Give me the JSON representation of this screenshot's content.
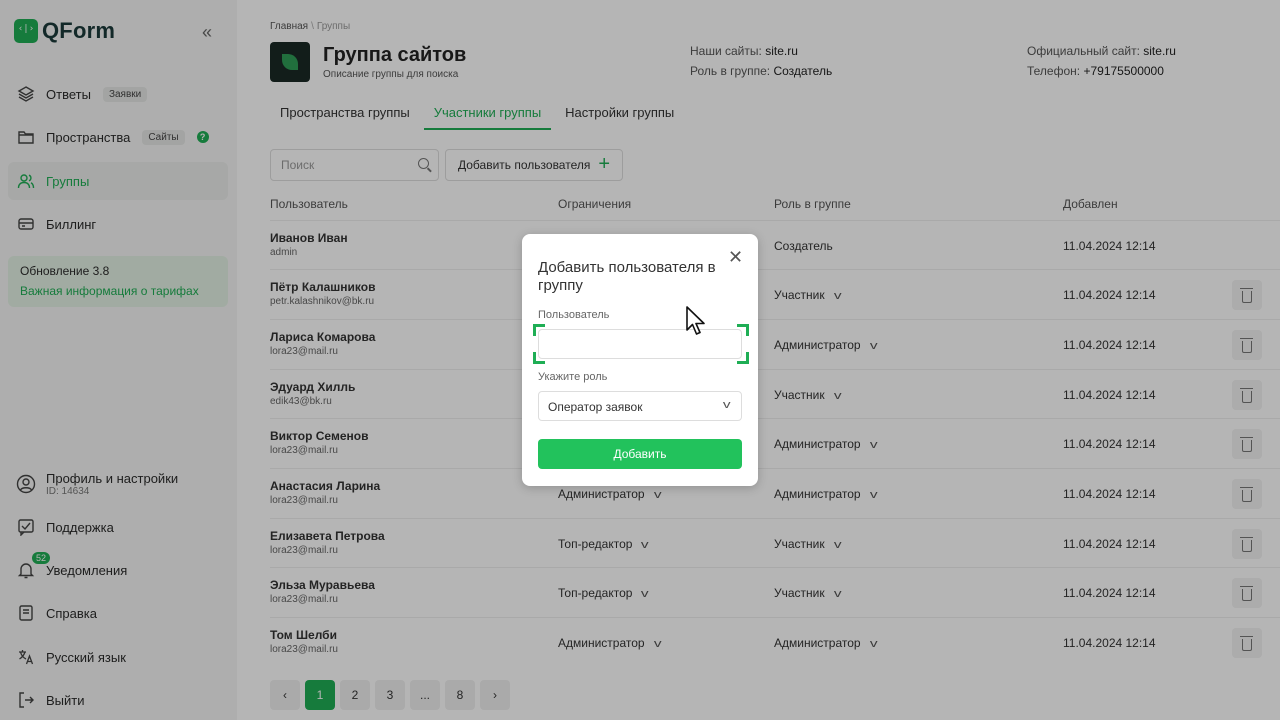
{
  "app": {
    "name": "QForm"
  },
  "sidebar": {
    "items": [
      {
        "label": "Ответы",
        "tag": "Заявки"
      },
      {
        "label": "Пространства",
        "tag": "Сайты"
      },
      {
        "label": "Группы"
      },
      {
        "label": "Биллинг"
      }
    ],
    "help_mark": "?",
    "update": {
      "title": "Обновление 3.8",
      "link": "Важная информация о тарифах"
    },
    "bottom": {
      "profile": "Профиль и настройки",
      "profile_id": "ID: 14634",
      "support": "Поддержка",
      "notifications": "Уведомления",
      "notifications_count": "52",
      "help": "Справка",
      "language": "Русский язык",
      "logout": "Выйти"
    }
  },
  "breadcrumb": {
    "home": "Главная",
    "current": "Группы"
  },
  "group": {
    "title": "Группа сайтов",
    "description": "Описание группы для поиска",
    "sites_label": "Наши сайты:",
    "sites_value": "site.ru",
    "role_label": "Роль в группе:",
    "role_value": "Создатель",
    "official_label": "Официальный сайт:",
    "official_value": "site.ru",
    "phone_label": "Телефон:",
    "phone_value": "+79175500000"
  },
  "tabs": [
    "Пространства группы",
    "Участники группы",
    "Настройки группы"
  ],
  "toolbar": {
    "search_placeholder": "Поиск",
    "add_user": "Добавить пользователя"
  },
  "table": {
    "headers": [
      "Пользователь",
      "Ограничения",
      "Роль в группе",
      "Добавлен"
    ],
    "rows": [
      {
        "name": "Иванов Иван",
        "email": "admin",
        "limit": "",
        "role": "Создатель",
        "date": "11.04.2024 12:14"
      },
      {
        "name": "Пётр Калашников",
        "email": "petr.kalashnikov@bk.ru",
        "limit": "",
        "role": "Участник",
        "date": "11.04.2024 12:14"
      },
      {
        "name": "Лариса Комарова",
        "email": "lora23@mail.ru",
        "limit": "",
        "role": "Администратор",
        "date": "11.04.2024 12:14"
      },
      {
        "name": "Эдуард Хилль",
        "email": "edik43@bk.ru",
        "limit": "",
        "role": "Участник",
        "date": "11.04.2024 12:14"
      },
      {
        "name": "Виктор Семенов",
        "email": "lora23@mail.ru",
        "limit": "",
        "role": "Администратор",
        "date": "11.04.2024 12:14"
      },
      {
        "name": "Анастасия Ларина",
        "email": "lora23@mail.ru",
        "limit": "Администратор",
        "role": "Администратор",
        "date": "11.04.2024 12:14"
      },
      {
        "name": "Елизавета Петрова",
        "email": "lora23@mail.ru",
        "limit": "Топ-редактор",
        "role": "Участник",
        "date": "11.04.2024 12:14"
      },
      {
        "name": "Эльза Муравьева",
        "email": "lora23@mail.ru",
        "limit": "Топ-редактор",
        "role": "Участник",
        "date": "11.04.2024 12:14"
      },
      {
        "name": "Том Шелби",
        "email": "lora23@mail.ru",
        "limit": "Администратор",
        "role": "Администратор",
        "date": "11.04.2024 12:14"
      }
    ]
  },
  "pagination": {
    "prev": "‹",
    "pages": [
      "1",
      "2",
      "3",
      "...",
      "8"
    ],
    "next": "›",
    "current": "1"
  },
  "modal": {
    "title": "Добавить пользователя в группу",
    "user_label": "Пользователь",
    "user_value": "",
    "role_label": "Укажите роль",
    "role_value": "Оператор заявок",
    "submit": "Добавить",
    "close": "✕"
  },
  "colors": {
    "accent": "#1fae55",
    "button": "#22c25c"
  }
}
